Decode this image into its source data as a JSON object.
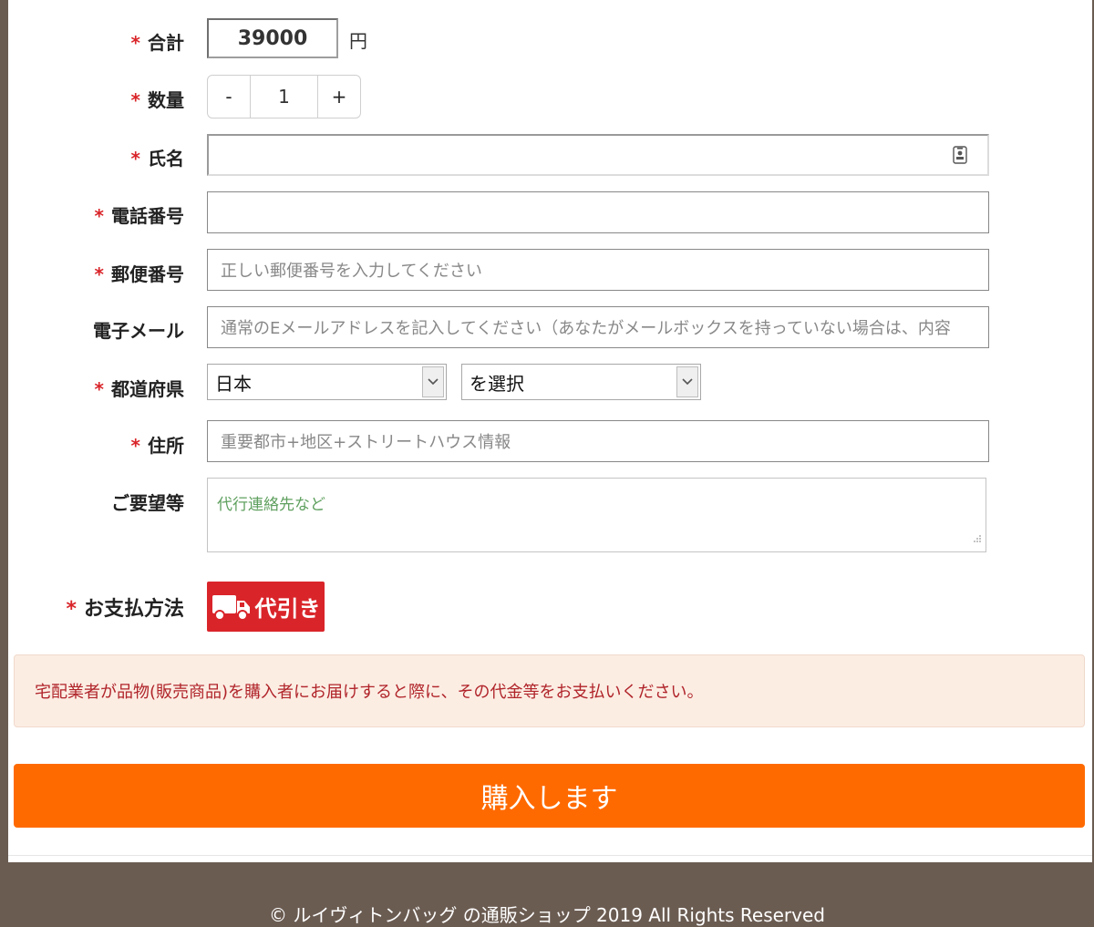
{
  "form": {
    "total": {
      "label": "合計",
      "value": "39000",
      "unit": "円"
    },
    "quantity": {
      "label": "数量",
      "minus": "-",
      "value": "1",
      "plus": "+"
    },
    "name": {
      "label": "氏名",
      "value": "",
      "placeholder": ""
    },
    "phone": {
      "label": "電話番号",
      "value": "",
      "placeholder": ""
    },
    "postal": {
      "label": "郵便番号",
      "placeholder": "正しい郵便番号を入力してください"
    },
    "email": {
      "label": "電子メール",
      "placeholder": "通常のEメールアドレスを記入してください（あなたがメールボックスを持っていない場合は、内容"
    },
    "prefecture": {
      "label": "都道府県",
      "country": "日本",
      "pref": "を選択"
    },
    "address": {
      "label": "住所",
      "placeholder": "重要都市+地区+ストリートハウス情報"
    },
    "notes": {
      "label": "ご要望等",
      "placeholder": "代行連絡先など"
    },
    "payment": {
      "label": "お支払方法",
      "method": "代引き",
      "icon": "truck-icon"
    }
  },
  "notice": "宅配業者が品物(販売商品)を購入者にお届けすると際に、その代金等をお支払いください。",
  "buy_button": "購入します",
  "footer": "© ルイヴィトンバッグ の通販ショップ 2019 All Rights Reserved",
  "colors": {
    "accent": "#ff6a00",
    "required": "#d9252a",
    "notice_bg": "#fcede3",
    "page_bg": "#6b5c52"
  }
}
